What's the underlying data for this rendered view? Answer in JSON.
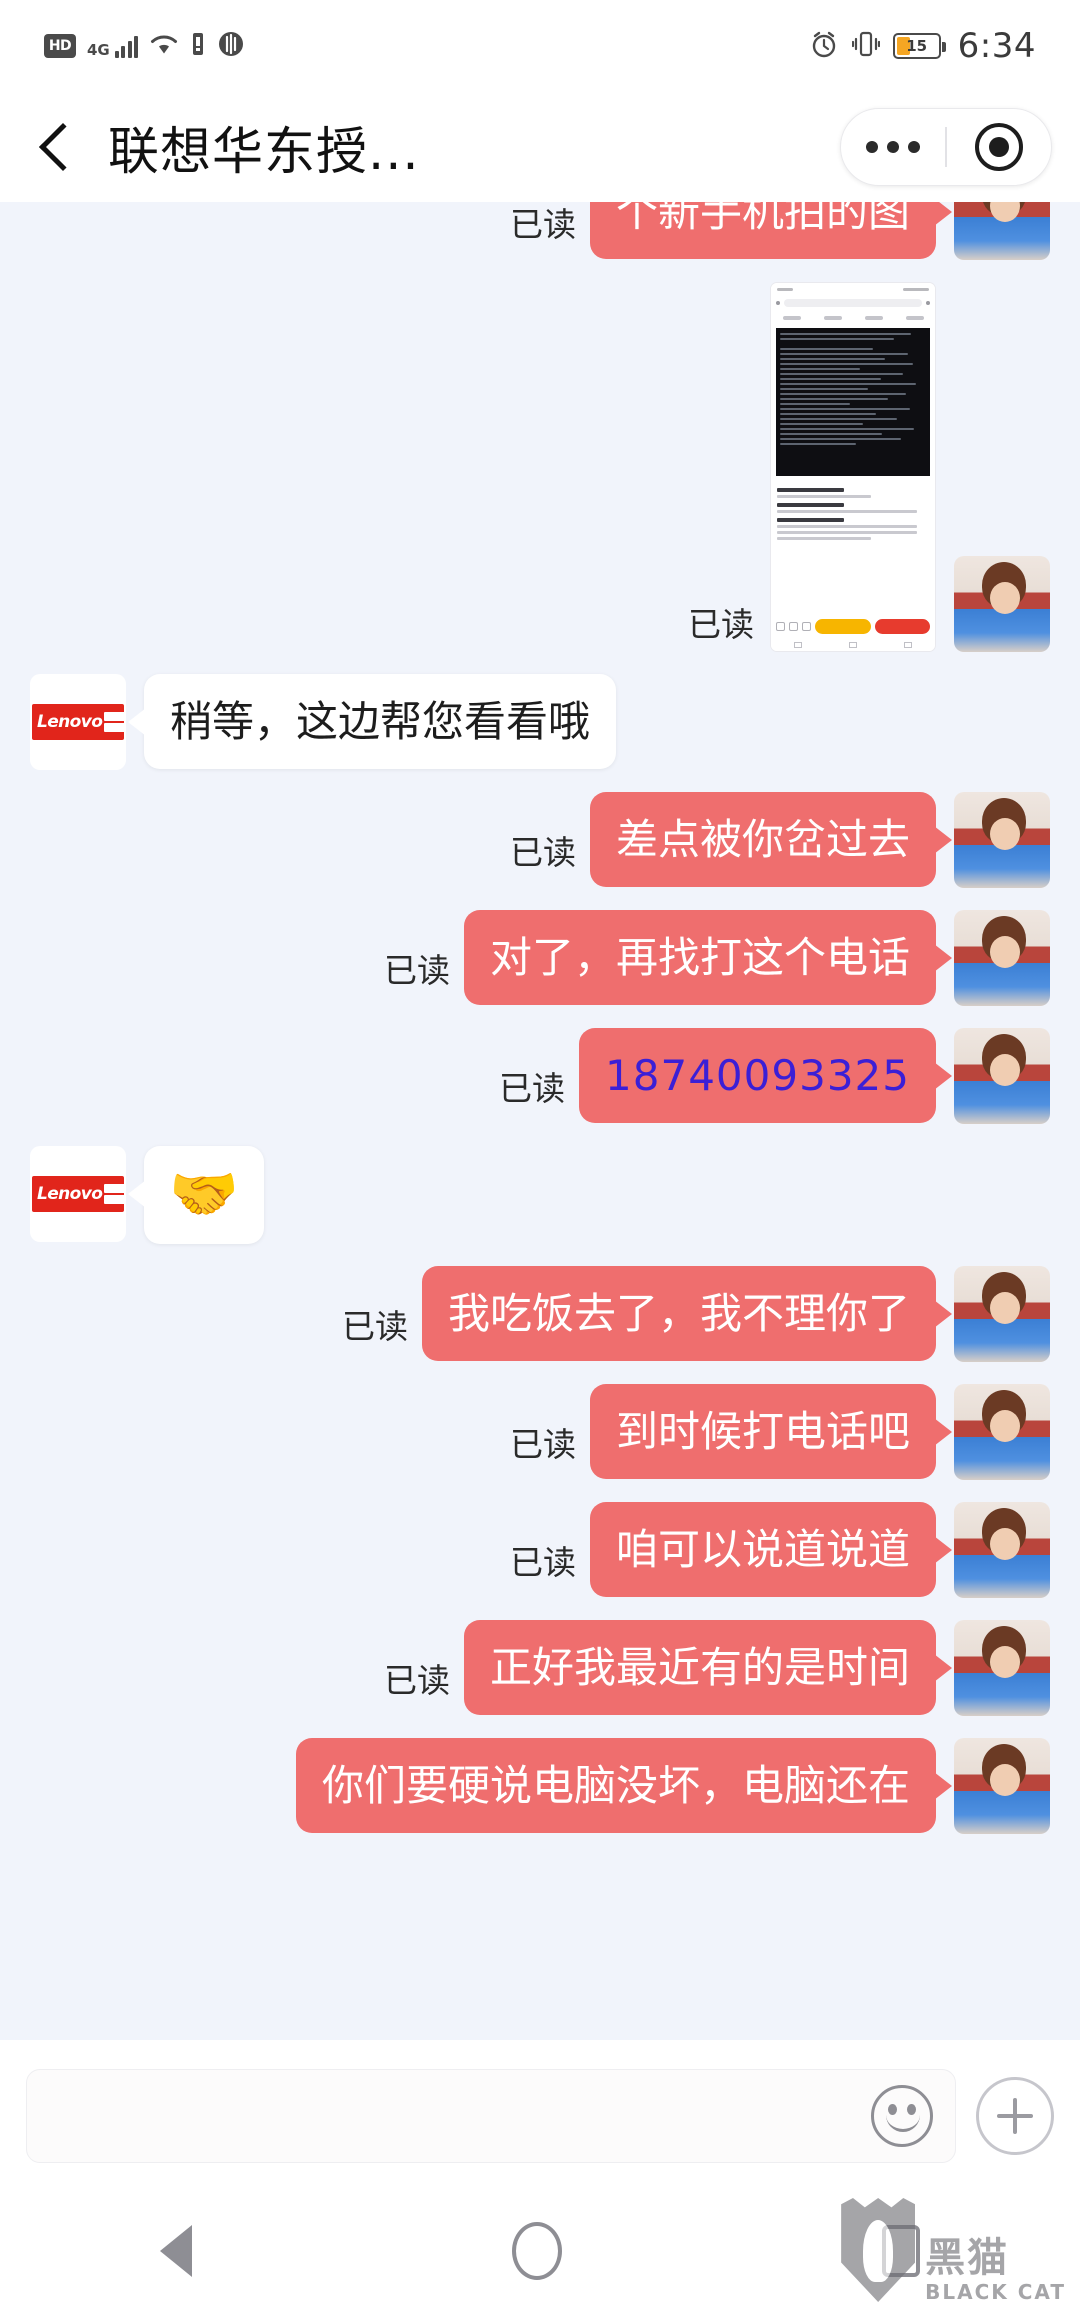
{
  "statusbar": {
    "hd_label": "HD",
    "network_label": "4G",
    "battery_percent": "15",
    "time": "6:34",
    "icons": [
      "hd-icon",
      "4g-icon",
      "signal-bars-icon",
      "wifi-icon",
      "usb-icon",
      "sound-wave-icon",
      "alarm-clock-icon",
      "vibrate-icon",
      "battery-icon"
    ]
  },
  "titlebar": {
    "title": "联想华东授...",
    "back_icon": "back-chevron-icon",
    "menu_icon": "more-options-icon",
    "close_icon": "target-circle-icon"
  },
  "messages": [
    {
      "id": "m1",
      "side": "out",
      "type": "text",
      "text": "个新手机拍的图",
      "read": "已读",
      "avatar": "girl"
    },
    {
      "id": "m2",
      "side": "out",
      "type": "image",
      "read": "已读",
      "avatar": "girl",
      "image_alt": "手机网页截图"
    },
    {
      "id": "m3",
      "side": "in",
      "type": "text",
      "text": "稍等，这边帮您看看哦",
      "avatar": "lenovo",
      "avatar_label": "Lenovo"
    },
    {
      "id": "m4",
      "side": "out",
      "type": "text",
      "text": "差点被你岔过去",
      "read": "已读",
      "avatar": "girl"
    },
    {
      "id": "m5",
      "side": "out",
      "type": "text",
      "text": "对了，再找打这个电话",
      "read": "已读",
      "avatar": "girl"
    },
    {
      "id": "m6",
      "side": "out",
      "type": "phone",
      "text": "18740093325",
      "read": "已读",
      "avatar": "girl"
    },
    {
      "id": "m7",
      "side": "in",
      "type": "emoji",
      "text": "🤝",
      "avatar": "lenovo",
      "avatar_label": "Lenovo"
    },
    {
      "id": "m8",
      "side": "out",
      "type": "text",
      "text": "我吃饭去了，我不理你了",
      "read": "已读",
      "avatar": "girl"
    },
    {
      "id": "m9",
      "side": "out",
      "type": "text",
      "text": "到时候打电话吧",
      "read": "已读",
      "avatar": "girl"
    },
    {
      "id": "m10",
      "side": "out",
      "type": "text",
      "text": "咱可以说道说道",
      "read": "已读",
      "avatar": "girl"
    },
    {
      "id": "m11",
      "side": "out",
      "type": "text",
      "text": "正好我最近有的是时间",
      "read": "已读",
      "avatar": "girl"
    },
    {
      "id": "m12",
      "side": "out",
      "type": "text",
      "text": "你们要硬说电脑没坏，电脑还在",
      "avatar": "girl"
    }
  ],
  "inputbar": {
    "value": "",
    "placeholder": "",
    "emoji_icon": "smiley-face-icon",
    "plus_icon": "plus-icon"
  },
  "navbar": {
    "back_icon": "nav-back-triangle-icon",
    "home_icon": "nav-home-circle-icon",
    "recents_icon": "nav-recents-square-icon"
  },
  "watermark": {
    "cn": "黑猫",
    "en": "BLACK CAT",
    "icon": "black-cat-shield-icon"
  },
  "colors": {
    "bubble_out": "#ef6e6e",
    "bubble_in": "#ffffff",
    "background": "#f1f4fb",
    "phone_link": "#3b1fd6",
    "lenovo_red": "#e1251b",
    "battery_orange": "#f5a623"
  }
}
